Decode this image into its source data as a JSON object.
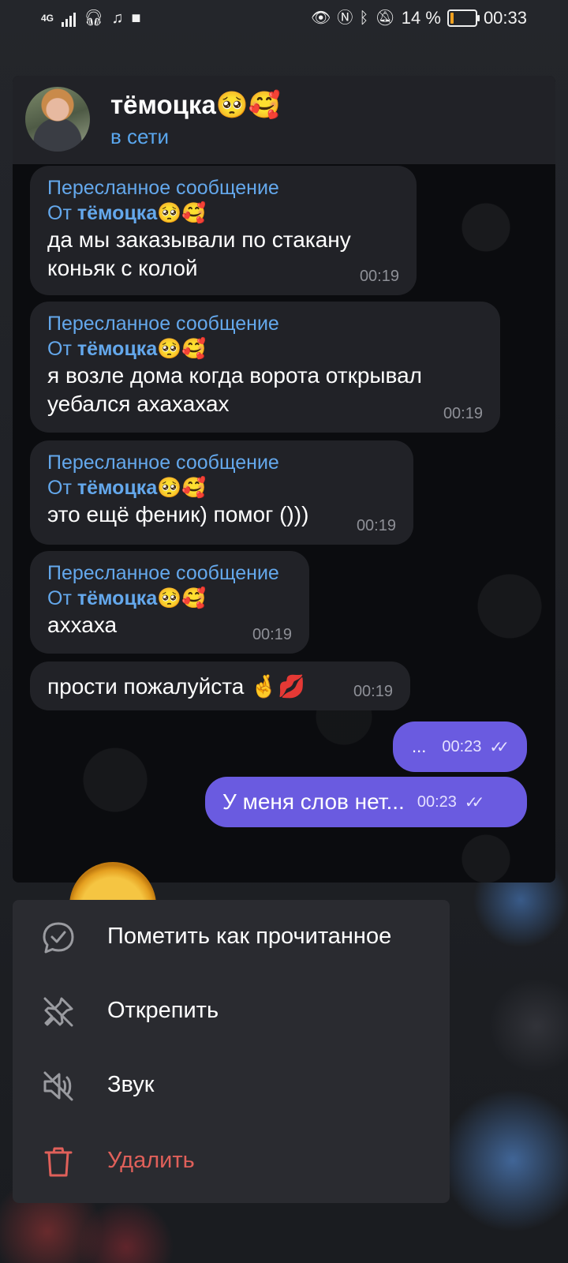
{
  "status_bar": {
    "network": "4G",
    "battery_text": "14 %",
    "time": "00:33",
    "battery_level": 0.14
  },
  "chat": {
    "name": "тёмоцка🥺🥰",
    "status": "в сети"
  },
  "messages": [
    {
      "forwarded_label": "Пересланное сообщение",
      "from_prefix": "От",
      "from_name": "тёмоцка🥺🥰",
      "lines": [
        "да мы заказывали по стакану",
        "коньяк с колой"
      ],
      "time": "00:19"
    },
    {
      "forwarded_label": "Пересланное сообщение",
      "from_prefix": "От",
      "from_name": "тёмоцка🥺🥰",
      "lines": [
        "я возле дома когда ворота открывал",
        "уебался ахахахах"
      ],
      "time": "00:19"
    },
    {
      "forwarded_label": "Пересланное сообщение",
      "from_prefix": "От",
      "from_name": "тёмоцка🥺🥰",
      "lines": [
        "это ещё феник) помог ()))"
      ],
      "time": "00:19"
    },
    {
      "forwarded_label": "Пересланное сообщение",
      "from_prefix": "От",
      "from_name": "тёмоцка🥺🥰",
      "lines": [
        "аххаха"
      ],
      "time": "00:19"
    },
    {
      "text": "прости пожалуйста 🤞💋",
      "time": "00:19"
    }
  ],
  "outgoing": [
    {
      "text": "...",
      "time": "00:23",
      "checks": "✓✓"
    },
    {
      "text": "У меня слов нет...",
      "time": "00:23",
      "checks": "✓✓"
    }
  ],
  "menu": {
    "items": [
      {
        "label": "Пометить как прочитанное",
        "icon": "chat-check-icon"
      },
      {
        "label": "Открепить",
        "icon": "unpin-icon"
      },
      {
        "label": "Звук",
        "icon": "muted-speaker-icon"
      },
      {
        "label": "Удалить",
        "icon": "trash-icon"
      }
    ]
  },
  "colors": {
    "accent_link": "#64a8ec",
    "outgoing_bubble": "#6a5be0",
    "danger": "#e0605a"
  }
}
